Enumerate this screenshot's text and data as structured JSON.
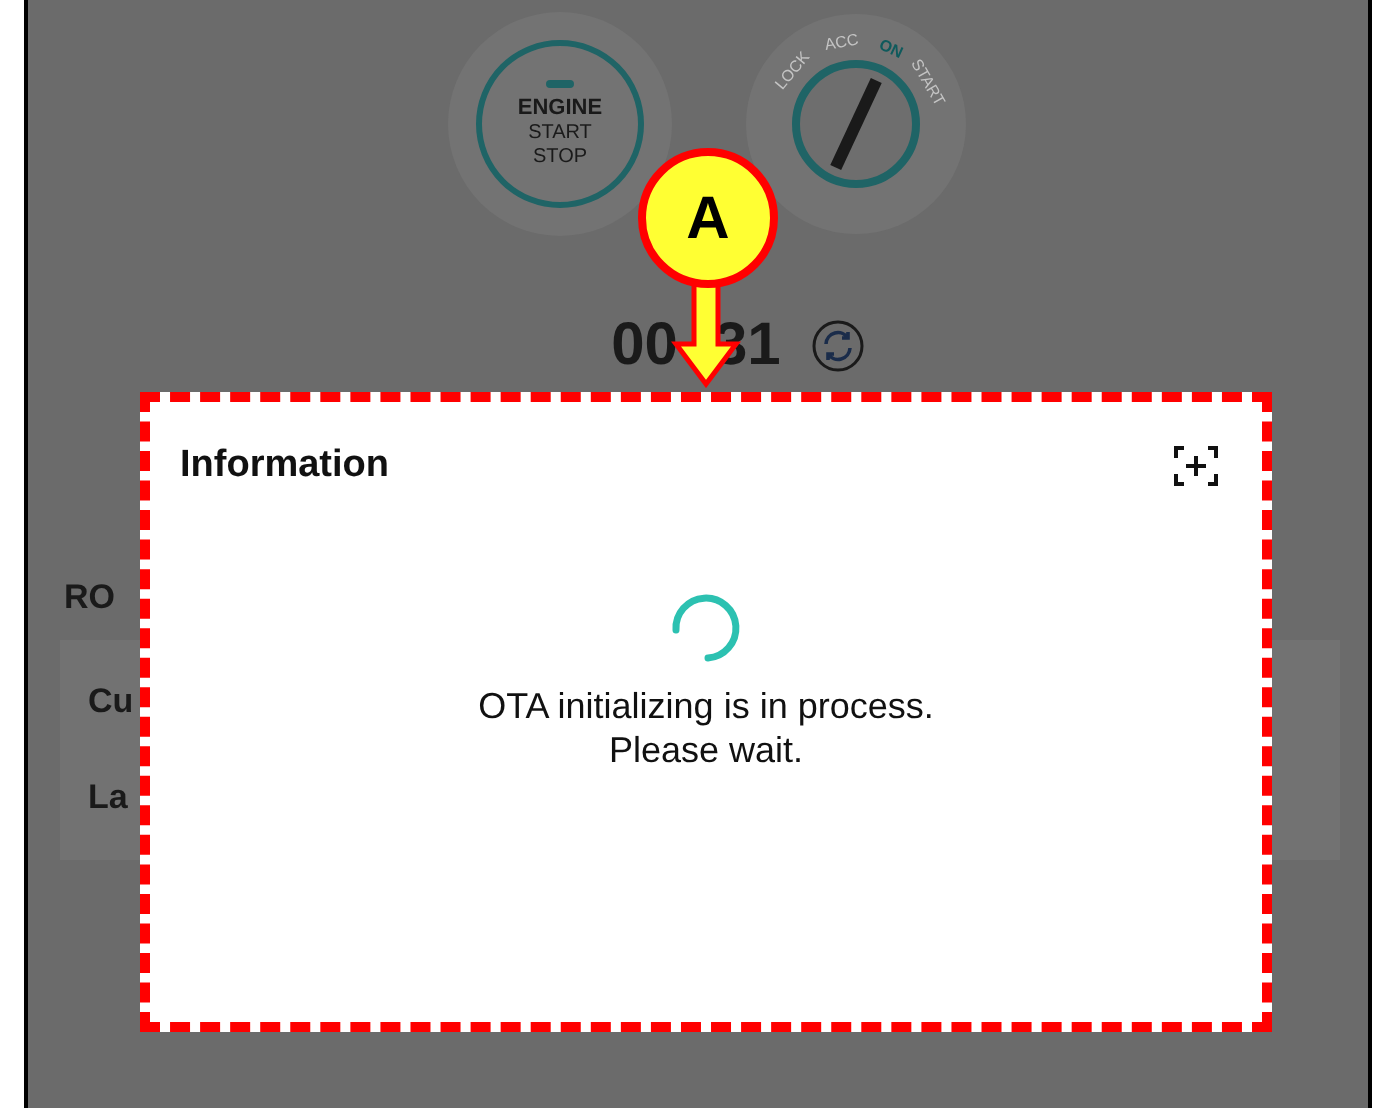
{
  "background": {
    "engine_button": {
      "lines": [
        "ENGINE",
        "START",
        "STOP"
      ]
    },
    "ignition": {
      "positions": [
        {
          "label": "LOCK",
          "selected": false
        },
        {
          "label": "ACC",
          "selected": false
        },
        {
          "label": "ON",
          "selected": true
        },
        {
          "label": "START",
          "selected": false
        }
      ]
    },
    "timer": [
      "00",
      "31"
    ],
    "section_title": "RO",
    "rows": [
      "Cu",
      "La"
    ]
  },
  "dialog": {
    "title": "Information",
    "message": [
      "OTA initializing is in process.",
      "Please wait."
    ]
  },
  "callout": {
    "label": "A"
  }
}
